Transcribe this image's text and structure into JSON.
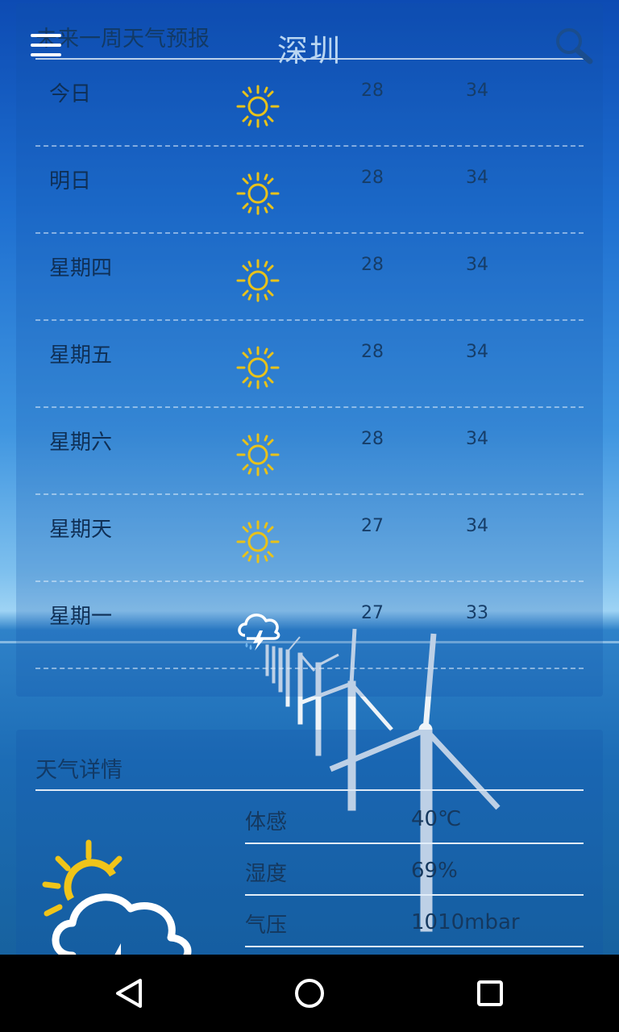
{
  "appbar": {
    "city": "深圳",
    "menu_icon": "hamburger-menu-icon",
    "search_icon": "search-icon"
  },
  "forecast": {
    "title": "未来一周天气预报",
    "rows": [
      {
        "day": "今日",
        "icon": "sunny-icon",
        "low": "28",
        "high": "34"
      },
      {
        "day": "明日",
        "icon": "sunny-icon",
        "low": "28",
        "high": "34"
      },
      {
        "day": "星期四",
        "icon": "sunny-icon",
        "low": "28",
        "high": "34"
      },
      {
        "day": "星期五",
        "icon": "sunny-icon",
        "low": "28",
        "high": "34"
      },
      {
        "day": "星期六",
        "icon": "sunny-icon",
        "low": "28",
        "high": "34"
      },
      {
        "day": "星期天",
        "icon": "sunny-icon",
        "low": "27",
        "high": "34"
      },
      {
        "day": "星期一",
        "icon": "thunderstorm-icon",
        "low": "27",
        "high": "33"
      }
    ]
  },
  "details": {
    "title": "天气详情",
    "icon": "sun-cloud-thunder-icon",
    "items": [
      {
        "label": "体感",
        "value": "40℃"
      },
      {
        "label": "湿度",
        "value": "69%"
      },
      {
        "label": "气压",
        "value": "1010mbar"
      }
    ]
  },
  "navbar": {
    "back": "back-triangle-icon",
    "home": "home-circle-icon",
    "recents": "recents-square-icon"
  },
  "colors": {
    "sun": "#e8c21a",
    "panel_text": "#123a66",
    "navbar": "#000000"
  }
}
